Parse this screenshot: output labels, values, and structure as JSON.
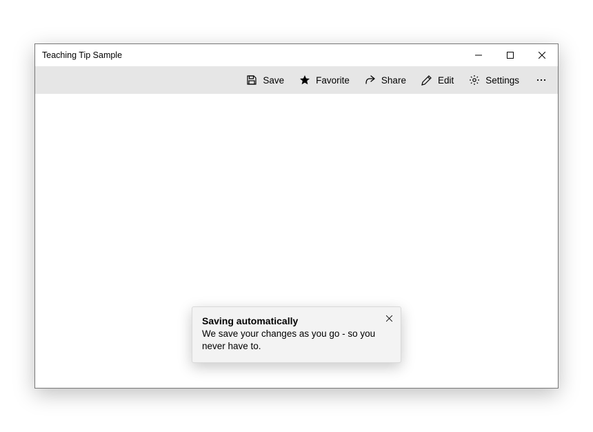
{
  "window": {
    "title": "Teaching Tip Sample"
  },
  "commandbar": {
    "save": "Save",
    "favorite": "Favorite",
    "share": "Share",
    "edit": "Edit",
    "settings": "Settings"
  },
  "teaching_tip": {
    "title": "Saving automatically",
    "body": "We save your changes as you go - so you never have to."
  }
}
